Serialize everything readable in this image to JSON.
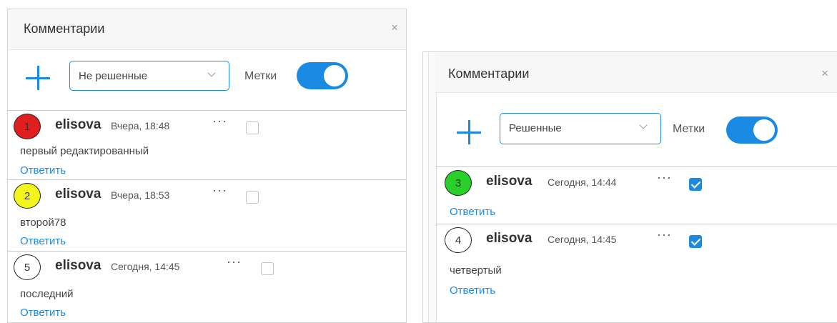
{
  "left_panel": {
    "title": "Комментарии",
    "close_glyph": "×",
    "filter": {
      "selected": "Не решенные"
    },
    "marks_label": "Метки",
    "marks_toggle_on": true,
    "comments": [
      {
        "number": "1",
        "badge_color": "#e01e1e",
        "author": "elisova",
        "time": "Вчера, 18:48",
        "menu": "···",
        "resolved": false,
        "text": "первый редактированный",
        "reply": "Ответить"
      },
      {
        "number": "2",
        "badge_color": "#f5f51e",
        "author": "elisova",
        "time": "Вчера, 18:53",
        "menu": "···",
        "resolved": false,
        "text": "второй78",
        "reply": "Ответить"
      },
      {
        "number": "5",
        "badge_color": "#ffffff",
        "author": "elisova",
        "time": "Сегодня, 14:45",
        "menu": "···",
        "resolved": false,
        "text": "последний",
        "reply": "Ответить"
      }
    ]
  },
  "right_panel": {
    "title": "Комментарии",
    "close_glyph": "×",
    "filter": {
      "selected": "Решенные"
    },
    "marks_label": "Метки",
    "marks_toggle_on": true,
    "comments": [
      {
        "number": "3",
        "badge_color": "#2ad02a",
        "author": "elisova",
        "time": "Сегодня, 14:44",
        "menu": "···",
        "resolved": true,
        "reply": "Ответить"
      },
      {
        "number": "4",
        "badge_color": "#ffffff",
        "author": "elisova",
        "time": "Сегодня, 14:45",
        "menu": "···",
        "resolved": true,
        "text": "четвертый",
        "reply": "Ответить"
      }
    ]
  },
  "icons": {
    "add": "plus-icon",
    "close": "close-icon",
    "dropdown": "chevron-down-icon",
    "menu": "more-dots-icon"
  },
  "colors": {
    "accent": "#1a8ae5"
  }
}
